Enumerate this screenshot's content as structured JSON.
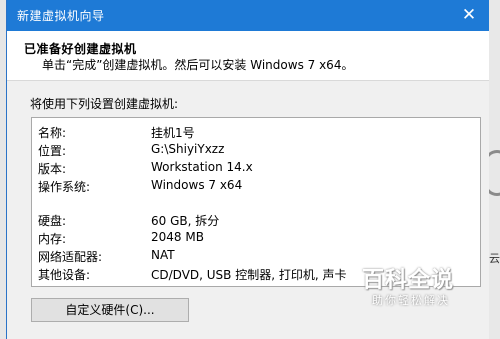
{
  "window": {
    "title": "新建虚拟机向导",
    "close_glyph": "✕"
  },
  "header": {
    "title": "已准备好创建虚拟机",
    "subtitle": "单击“完成”创建虚拟机。然后可以安装 Windows 7 x64。"
  },
  "summary": {
    "label": "将使用下列设置创建虚拟机:",
    "rows": [
      {
        "key": "名称:",
        "value": "挂机1号"
      },
      {
        "key": "位置:",
        "value": "G:\\ShiyiYxzz"
      },
      {
        "key": "版本:",
        "value": "Workstation 14.x"
      },
      {
        "key": "操作系统:",
        "value": "Windows 7 x64"
      },
      {
        "key": "硬盘:",
        "value": "60 GB, 拆分"
      },
      {
        "key": "内存:",
        "value": "2048 MB"
      },
      {
        "key": "网络适配器:",
        "value": "NAT"
      },
      {
        "key": "其他设备:",
        "value": "CD/DVD, USB 控制器, 打印机, 声卡"
      }
    ]
  },
  "buttons": {
    "customize_hardware": "自定义硬件(C)..."
  },
  "watermark": {
    "main": "百科全说",
    "sub": "助你轻松解决"
  },
  "background": {
    "right_fragment": "云"
  }
}
